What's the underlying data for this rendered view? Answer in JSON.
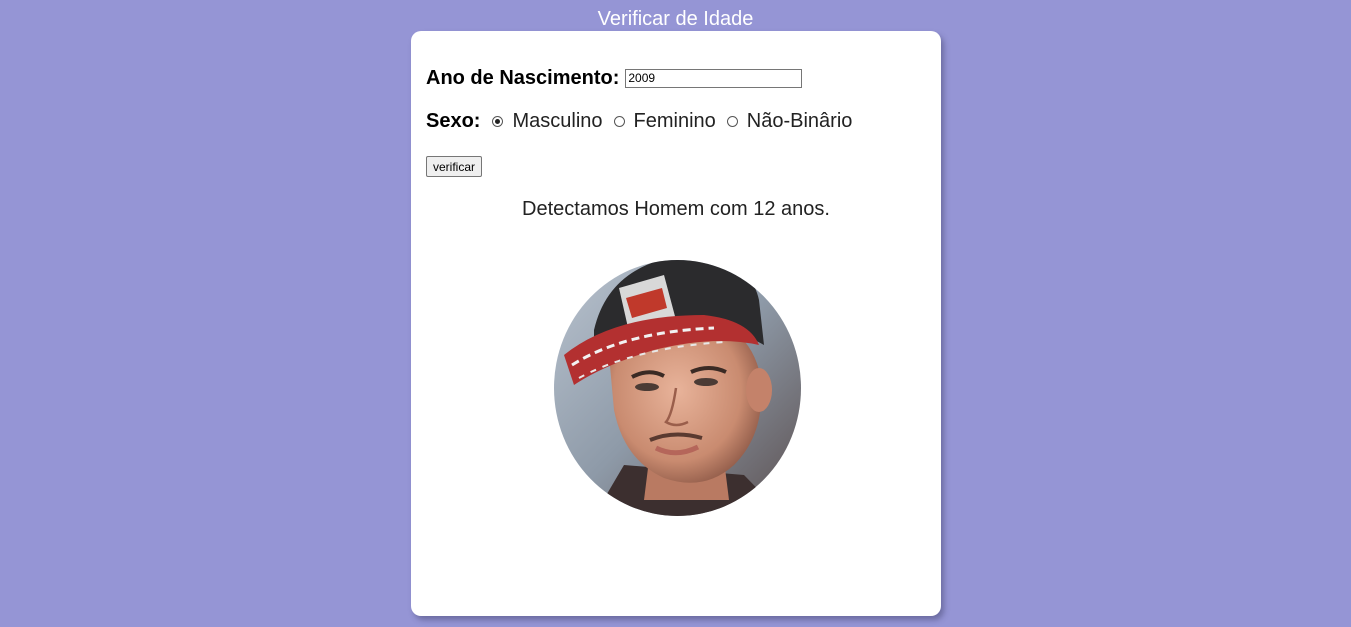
{
  "header": {
    "title": "Verificar de Idade"
  },
  "form": {
    "ano_label": "Ano de Nascimento:",
    "ano_value": "2009",
    "sexo_label": "Sexo:",
    "sexo_options": [
      {
        "label": "Masculino",
        "checked": true
      },
      {
        "label": "Feminino",
        "checked": false
      },
      {
        "label": "Não-Binârio",
        "checked": false
      }
    ],
    "button_label": "verificar"
  },
  "result": {
    "text": "Detectamos Homem com 12 anos.",
    "photo_icon": "young-man-portrait"
  },
  "colors": {
    "background": "#9595d5",
    "card": "#ffffff",
    "header_text": "#ffffff"
  }
}
